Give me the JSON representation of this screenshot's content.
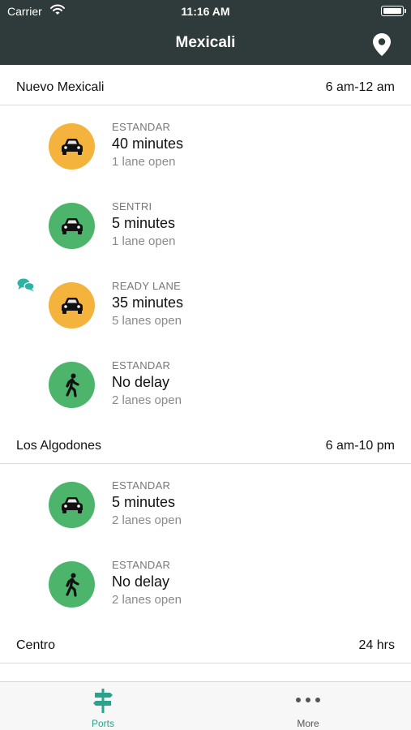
{
  "status_bar": {
    "carrier": "Carrier",
    "time": "11:16 AM"
  },
  "nav": {
    "title": "Mexicali"
  },
  "colors": {
    "yellow": "#f3b33d",
    "green": "#4db56b",
    "accent": "#2aa38a",
    "header": "#2f3a3a"
  },
  "sections": [
    {
      "name": "Nuevo Mexicali",
      "hours": "6 am-12 am",
      "lanes": [
        {
          "type": "ESTANDAR",
          "wait": "40 minutes",
          "open": "1 lane open",
          "icon": "car-icon",
          "status": "yellow"
        },
        {
          "type": "SENTRI",
          "wait": "5 minutes",
          "open": "1 lane open",
          "icon": "car-icon",
          "status": "green"
        },
        {
          "type": "READY LANE",
          "wait": "35 minutes",
          "open": "5 lanes open",
          "icon": "car-icon",
          "status": "yellow",
          "comment": true
        },
        {
          "type": "ESTANDAR",
          "wait": "No delay",
          "open": "2 lanes open",
          "icon": "pedestrian-icon",
          "status": "green"
        }
      ]
    },
    {
      "name": "Los Algodones",
      "hours": "6 am-10 pm",
      "lanes": [
        {
          "type": "ESTANDAR",
          "wait": "5 minutes",
          "open": "2 lanes open",
          "icon": "car-icon",
          "status": "green"
        },
        {
          "type": "ESTANDAR",
          "wait": "No delay",
          "open": "2 lanes open",
          "icon": "pedestrian-icon",
          "status": "green"
        }
      ]
    },
    {
      "name": "Centro",
      "hours": "24 hrs",
      "lanes": []
    }
  ],
  "tabs": [
    {
      "label": "Ports",
      "icon": "signpost-icon",
      "active": true
    },
    {
      "label": "More",
      "icon": "ellipsis-icon",
      "active": false
    }
  ]
}
